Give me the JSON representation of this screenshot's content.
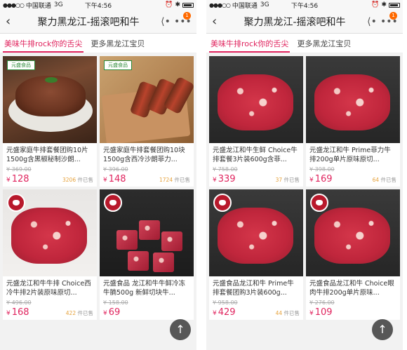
{
  "status": {
    "signal": "●●●○○",
    "carrier": "中国联通",
    "network": "3G",
    "time": "下午4:56",
    "alarm_icon": "alarm-icon",
    "bluetooth_icon": "bluetooth-icon"
  },
  "nav": {
    "back": "‹",
    "title": "聚力黑龙江-摇滚吧和牛",
    "share_icon": "share-icon",
    "more_icon": "more-icon",
    "more_badge": "1"
  },
  "tabs": [
    "美味牛排rock你的舌尖",
    "更多黑龙江宝贝"
  ],
  "brand_tag": "元盛食品",
  "left_products": [
    {
      "title": "元盛家庭牛排套餐团购10片1500g含黑椒秘制沙朗...",
      "orig": "¥ 369.00",
      "yen": "¥",
      "price": "128",
      "sold": "3206",
      "sold_suffix": "件已售"
    },
    {
      "title": "元盛家庭牛排套餐团购10块1500g含西冷沙朗菲力...",
      "orig": "¥ 396.00",
      "yen": "¥",
      "price": "148",
      "sold": "1724",
      "sold_suffix": "件已售"
    },
    {
      "title": "元盛龙江和牛牛排 Choice西冷牛排2片装原味原切...",
      "orig": "¥ 496.00",
      "yen": "¥",
      "price": "168",
      "sold": "422",
      "sold_suffix": "件已售"
    },
    {
      "title": "元盛食品 龙江和牛牛鲜冷冻牛腩500g 新鲜切块牛...",
      "orig": "¥ 158.00",
      "yen": "¥",
      "price": "69",
      "sold": "",
      "sold_suffix": ""
    }
  ],
  "right_products": [
    {
      "title": "元盛龙江和牛生鲜 Choice牛排套餐3片装600g含菲...",
      "orig": "¥ 758.00",
      "yen": "¥",
      "price": "339",
      "sold": "37",
      "sold_suffix": "件已售"
    },
    {
      "title": "元盛龙江和牛 Prime菲力牛排200g单片原味原切...",
      "orig": "¥ 398.00",
      "yen": "¥",
      "price": "169",
      "sold": "64",
      "sold_suffix": "件已售"
    },
    {
      "title": "元盛食品龙江和牛 Prime牛排套餐团购3片装600g...",
      "orig": "¥ 958.00",
      "yen": "¥",
      "price": "429",
      "sold": "44",
      "sold_suffix": "件已售"
    },
    {
      "title": "元盛食品龙江和牛 Choice眼肉牛排200g单片原味...",
      "orig": "¥ 276.00",
      "yen": "¥",
      "price": "109",
      "sold": "",
      "sold_suffix": ""
    }
  ],
  "scroll_top": "↑"
}
